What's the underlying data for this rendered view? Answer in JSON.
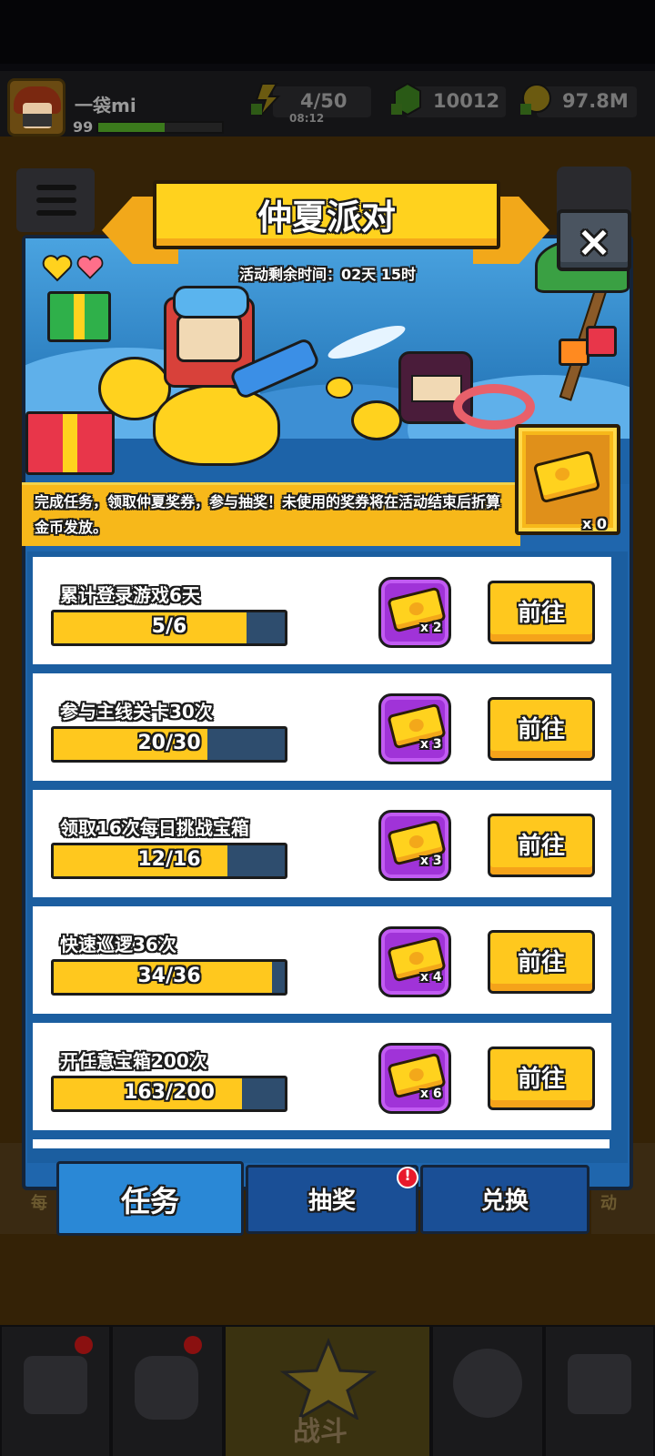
{
  "status_bar": {
    "text": ""
  },
  "player": {
    "name": "一袋mi",
    "level": "99",
    "xp_fraction": 0.54
  },
  "resources": {
    "energy": {
      "value": "4/50",
      "timer": "08:12",
      "icon": "lightning-icon"
    },
    "gems": {
      "value": "10012",
      "icon": "gem-icon"
    },
    "coins": {
      "value": "97.8M",
      "icon": "coin-icon"
    }
  },
  "event": {
    "title": "仲夏派对",
    "countdown": "活动剩余时间：02天 15时",
    "description": "完成任务，领取仲夏奖券，参与抽奖！未使用的奖券将在活动结束后折算金币发放。",
    "ticket_count": "x 0",
    "close_label": "×"
  },
  "tasks": [
    {
      "title": "累计登录游戏6天",
      "progress": "5/6",
      "fraction": 0.833,
      "reward": "x 2",
      "button": "前往"
    },
    {
      "title": "参与主线关卡30次",
      "progress": "20/30",
      "fraction": 0.667,
      "reward": "x 3",
      "button": "前往"
    },
    {
      "title": "领取16次每日挑战宝箱",
      "progress": "12/16",
      "fraction": 0.75,
      "reward": "x 3",
      "button": "前往"
    },
    {
      "title": "快速巡逻36次",
      "progress": "34/36",
      "fraction": 0.944,
      "reward": "x 4",
      "button": "前往"
    },
    {
      "title": "开任意宝箱200次",
      "progress": "163/200",
      "fraction": 0.815,
      "reward": "x 6",
      "button": "前往"
    }
  ],
  "tabs": {
    "task": "任务",
    "draw": "抽奖",
    "exchange": "兑换",
    "draw_badge": "!"
  },
  "background": {
    "left_tab": "每",
    "right_tab": "动"
  },
  "bottom_nav": {
    "battle": "战斗"
  },
  "colors": {
    "accent_yellow": "#ffc81e",
    "panel_blue": "#1f66ad",
    "reward_purple": "#a033d8",
    "badge_red": "#e8192c"
  }
}
